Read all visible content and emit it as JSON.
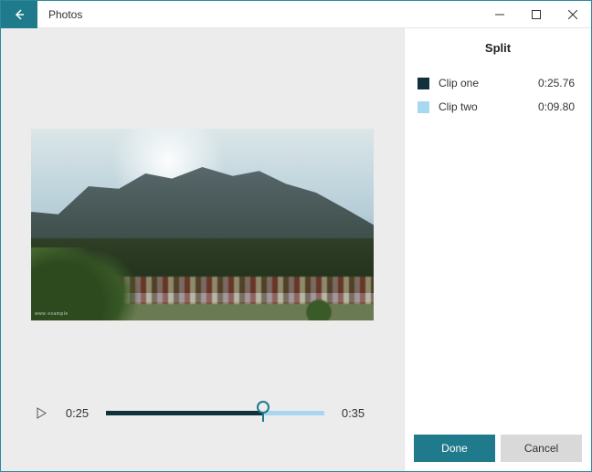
{
  "title": "Photos",
  "panel": {
    "title": "Split",
    "clips": [
      {
        "name": "Clip one",
        "time": "0:25.76",
        "color": "#13313d"
      },
      {
        "name": "Clip two",
        "time": "0:09.80",
        "color": "#a7d8f0"
      }
    ],
    "done": "Done",
    "cancel": "Cancel"
  },
  "player": {
    "current": "0:25",
    "total": "0:35",
    "split_fraction": 0.72
  },
  "colors": {
    "accent": "#1f7a8c"
  }
}
